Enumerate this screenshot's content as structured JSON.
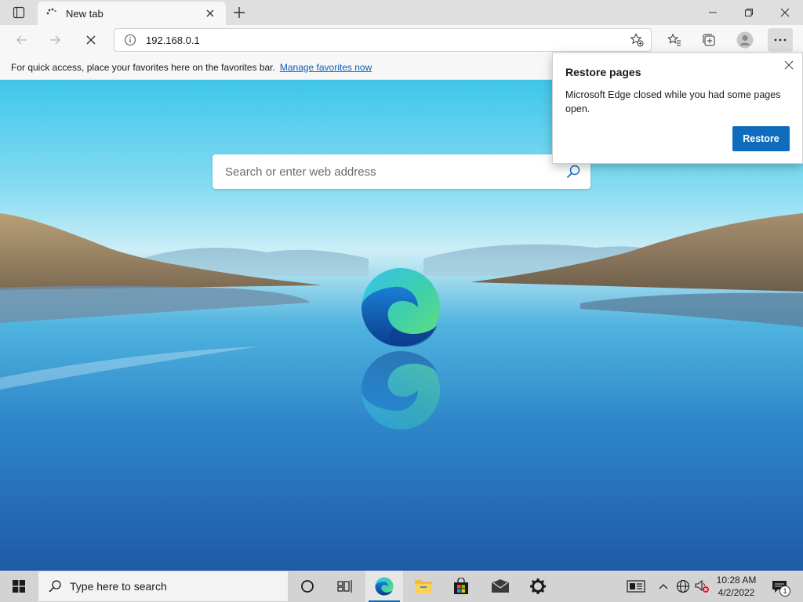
{
  "browser": {
    "tab": {
      "title": "New tab",
      "close_icon": "close-icon",
      "loading_icon": "spinner-icon"
    },
    "new_tab_icon": "plus-icon",
    "window_controls": [
      "minimize-icon",
      "maximize-icon",
      "close-icon"
    ],
    "address_bar": {
      "url": "192.168.0.1",
      "info_icon": "info-icon",
      "favorite_add_icon": "star-plus-icon"
    },
    "nav": {
      "back_icon": "back-arrow-icon",
      "forward_icon": "forward-arrow-icon",
      "stop_icon": "stop-icon"
    },
    "toolbar_icons": [
      "favorites-icon",
      "collections-icon",
      "profile-icon",
      "more-icon"
    ],
    "favorites_bar": {
      "message": "For quick access, place your favorites here on the favorites bar.",
      "link": "Manage favorites now"
    }
  },
  "new_tab_page": {
    "search_placeholder": "Search or enter web address",
    "search_icon": "search-icon",
    "logo": "edge-logo"
  },
  "restore_popup": {
    "title": "Restore pages",
    "body": "Microsoft Edge closed while you had some pages open.",
    "button": "Restore"
  },
  "taskbar": {
    "search_text": "Type here to search",
    "pinned": [
      "cortana-icon",
      "task-view-icon",
      "edge-icon",
      "file-explorer-icon",
      "store-icon",
      "mail-icon",
      "settings-icon"
    ],
    "tray": [
      "news-icon",
      "chevron-up-icon",
      "network-icon",
      "volume-muted-icon"
    ],
    "time": "10:28 AM",
    "date": "4/2/2022",
    "notification_count": "1"
  },
  "colors": {
    "accent": "#0f6cbd",
    "link": "#0a5fb4",
    "taskbar": "#d3d3d3"
  }
}
